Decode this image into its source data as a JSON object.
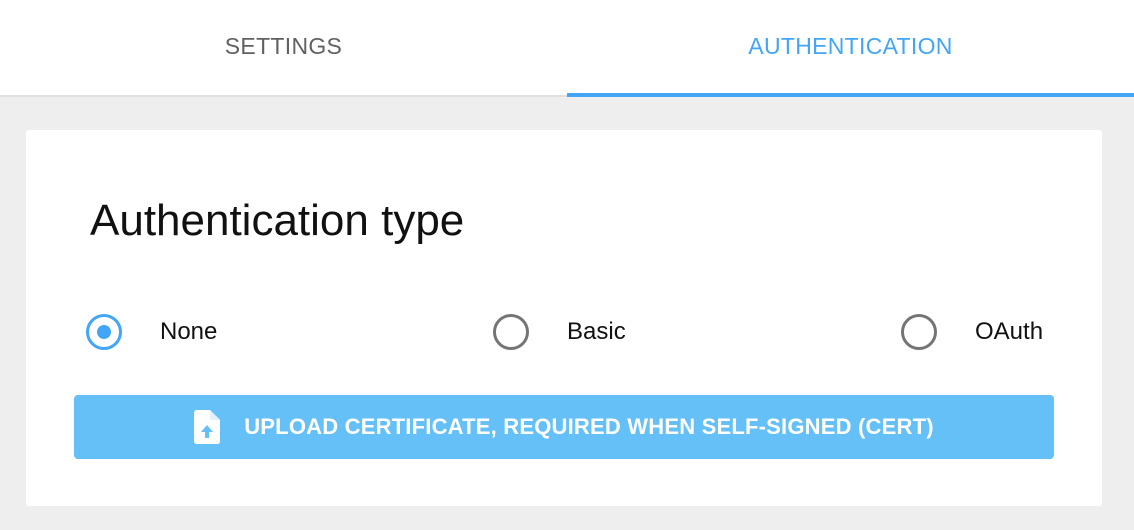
{
  "tabs": [
    {
      "label": "SETTINGS",
      "active": false
    },
    {
      "label": "AUTHENTICATION",
      "active": true
    }
  ],
  "auth": {
    "title": "Authentication type",
    "options": [
      {
        "label": "None",
        "selected": true
      },
      {
        "label": "Basic",
        "selected": false
      },
      {
        "label": "OAuth",
        "selected": false
      }
    ],
    "upload_button": {
      "label": "UPLOAD CERTIFICATE, REQUIRED WHEN SELF-SIGNED (CERT)",
      "icon": "file-upload-icon"
    }
  },
  "colors": {
    "accent": "#42a5f5",
    "button": "#64c0f7",
    "background": "#eeeeee"
  }
}
